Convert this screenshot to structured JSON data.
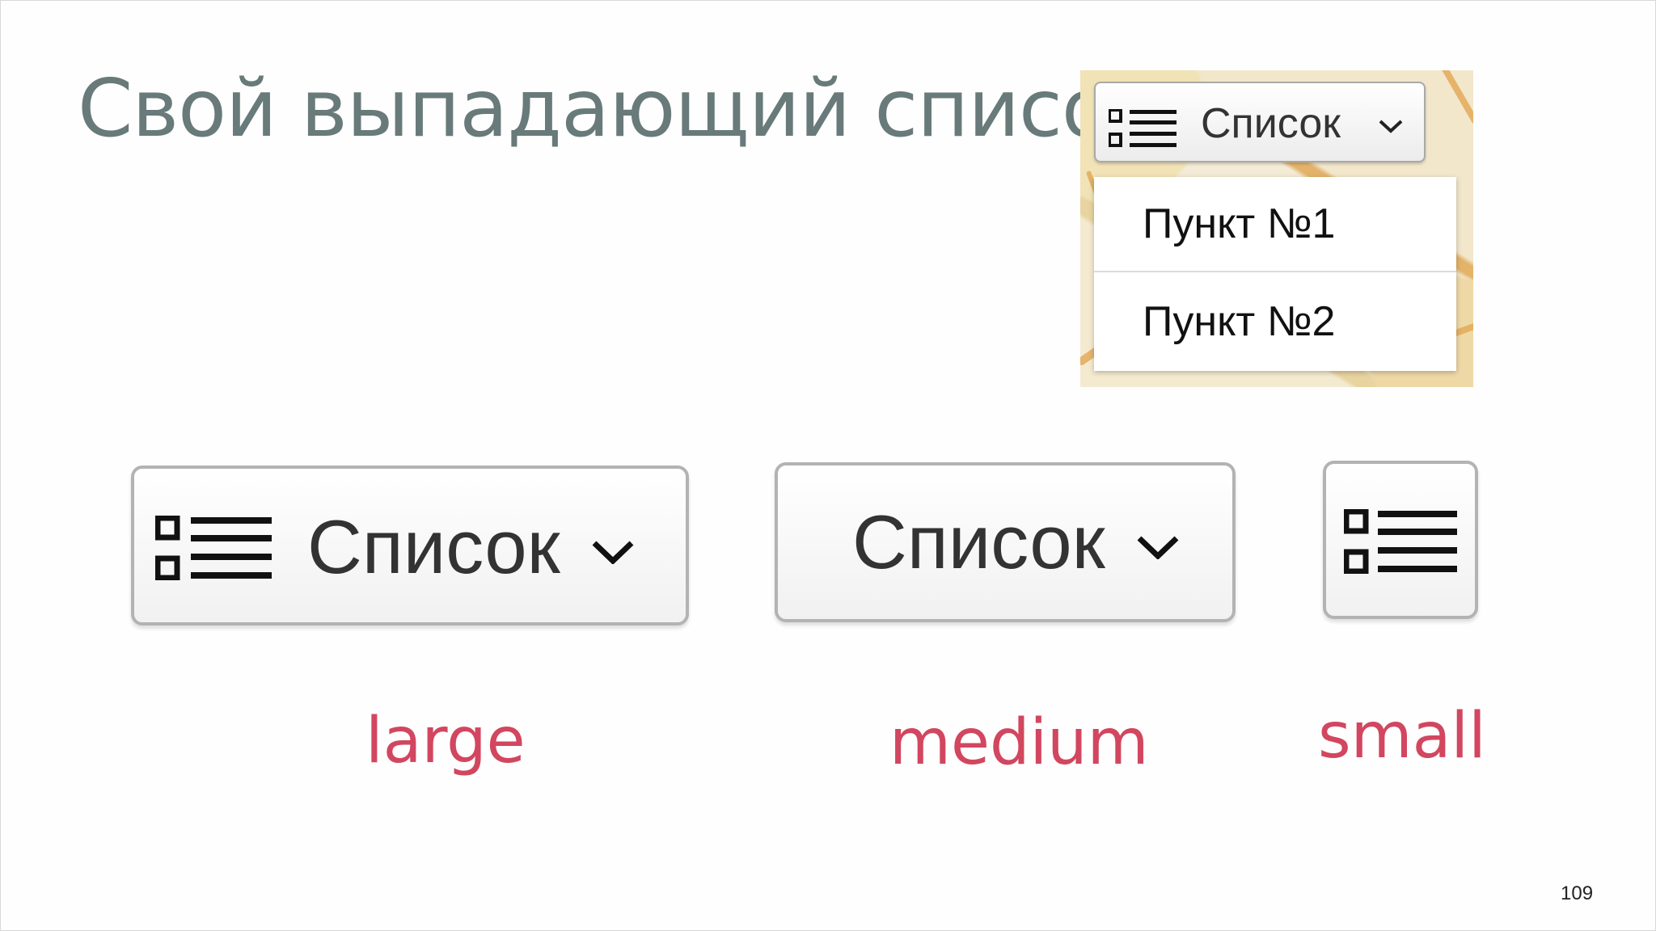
{
  "slide": {
    "title": "Свой выпадающий список",
    "page_number": "109"
  },
  "preview": {
    "toggle_label": "Список",
    "menu_items": [
      "Пункт №1",
      "Пункт №2"
    ]
  },
  "variants": {
    "large": {
      "label": "Список",
      "caption": "large",
      "icons": [
        "list-icon",
        "chevron-down-icon"
      ]
    },
    "medium": {
      "label": "Список",
      "caption": "medium",
      "icons": [
        "chevron-down-icon"
      ]
    },
    "small": {
      "caption": "small",
      "icons": [
        "list-icon"
      ]
    }
  },
  "colors": {
    "title": "#687a79",
    "caption": "#d2465f",
    "button_border": "#b3b3b3",
    "button_text": "#333333"
  }
}
